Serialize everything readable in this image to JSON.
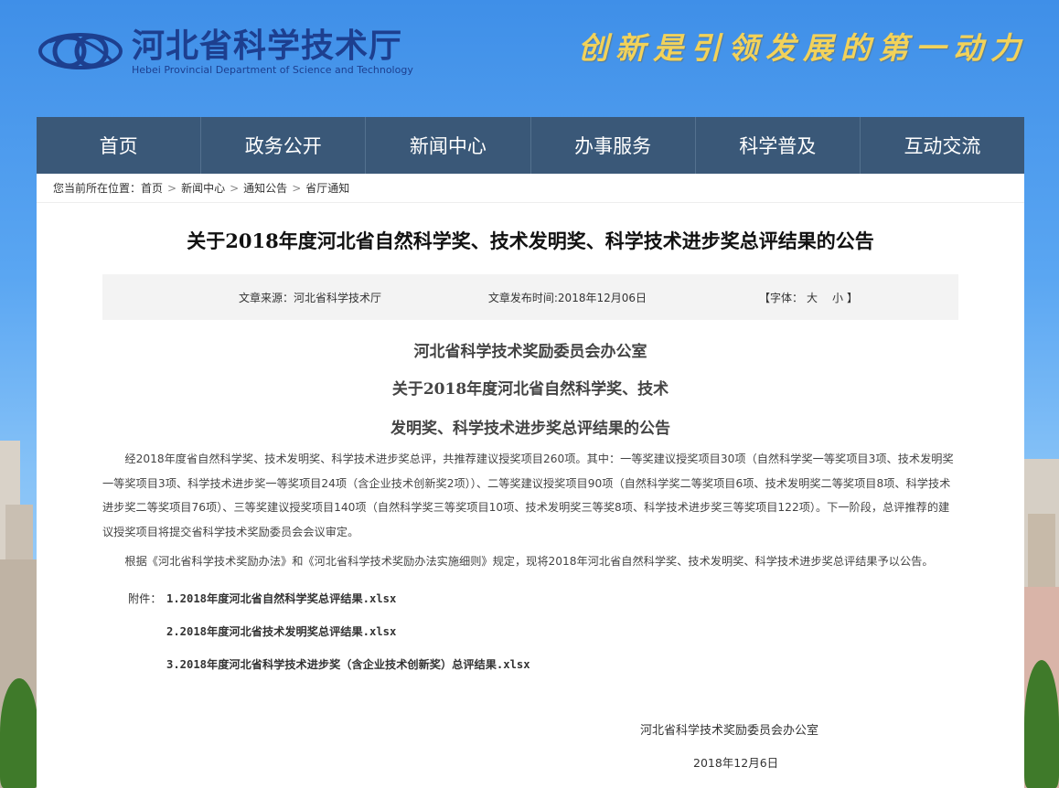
{
  "header": {
    "org_name_cn": "河北省科学技术厅",
    "org_name_en": "Hebei Provincial Department of Science and Technology",
    "slogan": "创新是引领发展的第一动力",
    "logo_icon": "hebei-science-logo-icon"
  },
  "nav": {
    "items": [
      {
        "label": "首页"
      },
      {
        "label": "政务公开"
      },
      {
        "label": "新闻中心"
      },
      {
        "label": "办事服务"
      },
      {
        "label": "科学普及"
      },
      {
        "label": "互动交流"
      }
    ]
  },
  "breadcrumb": {
    "prefix": "您当前所在位置：",
    "items": [
      "首页",
      "新闻中心",
      "通知公告",
      "省厅通知"
    ]
  },
  "article": {
    "title": "关于2018年度河北省自然科学奖、技术发明奖、科学技术进步奖总评结果的公告",
    "meta": {
      "source": "文章来源：河北省科学技术厅",
      "date": "文章发布时间:2018年12月06日",
      "font_label": "【字体：",
      "font_large": "大",
      "font_small": "小",
      "font_close": "】"
    },
    "heading_line1": "河北省科学技术奖励委员会办公室",
    "heading_line2": "关于2018年度河北省自然科学奖、技术",
    "heading_line3": "发明奖、科学技术进步奖总评结果的公告",
    "paragraph1": "经2018年度省自然科学奖、技术发明奖、科学技术进步奖总评，共推荐建议授奖项目260项。其中：一等奖建议授奖项目30项（自然科学奖一等奖项目3项、技术发明奖一等奖项目3项、科学技术进步奖一等奖项目24项（含企业技术创新奖2项））、二等奖建议授奖项目90项（自然科学奖二等奖项目6项、技术发明奖二等奖项目8项、科学技术进步奖二等奖项目76项）、三等奖建议授奖项目140项（自然科学奖三等奖项目10项、技术发明奖三等奖8项、科学技术进步奖三等奖项目122项）。下一阶段，总评推荐的建议授奖项目将提交省科学技术奖励委员会会议审定。",
    "paragraph2": "根据《河北省科学技术奖励办法》和《河北省科学技术奖励办法实施细则》规定，现将2018年河北省自然科学奖、技术发明奖、科学技术进步奖总评结果予以公告。",
    "attachments_label": "附件：",
    "attachments": [
      "1.2018年度河北省自然科学奖总评结果.xlsx",
      "2.2018年度河北省技术发明奖总评结果.xlsx",
      "3.2018年度河北省科学技术进步奖（含企业技术创新奖）总评结果.xlsx"
    ],
    "signature": "河北省科学技术奖励委员会办公室",
    "signature_date": "2018年12月6日"
  },
  "colors": {
    "nav_bg": "#3a5878",
    "brand_blue": "#1d3f8f",
    "slogan": "#f2d25a"
  }
}
